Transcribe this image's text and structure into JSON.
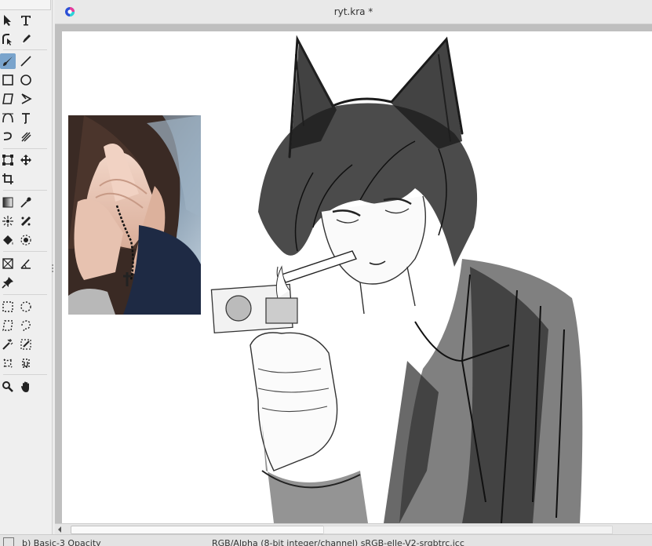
{
  "document": {
    "title": "ryt.kra *"
  },
  "toolbox": {
    "active_tool": "freehand-brush"
  },
  "statusbar": {
    "brush_preset": "b) Basic-3 Opacity",
    "color_space": "RGB/Alpha (8-bit integer/channel)  sRGB-elle-V2-srgbtrc.icc"
  },
  "colors": {
    "active_tool_bg": "#7aa4cc",
    "canvas_bg": "#ffffff",
    "workspace_bg": "#bfbfbf"
  }
}
